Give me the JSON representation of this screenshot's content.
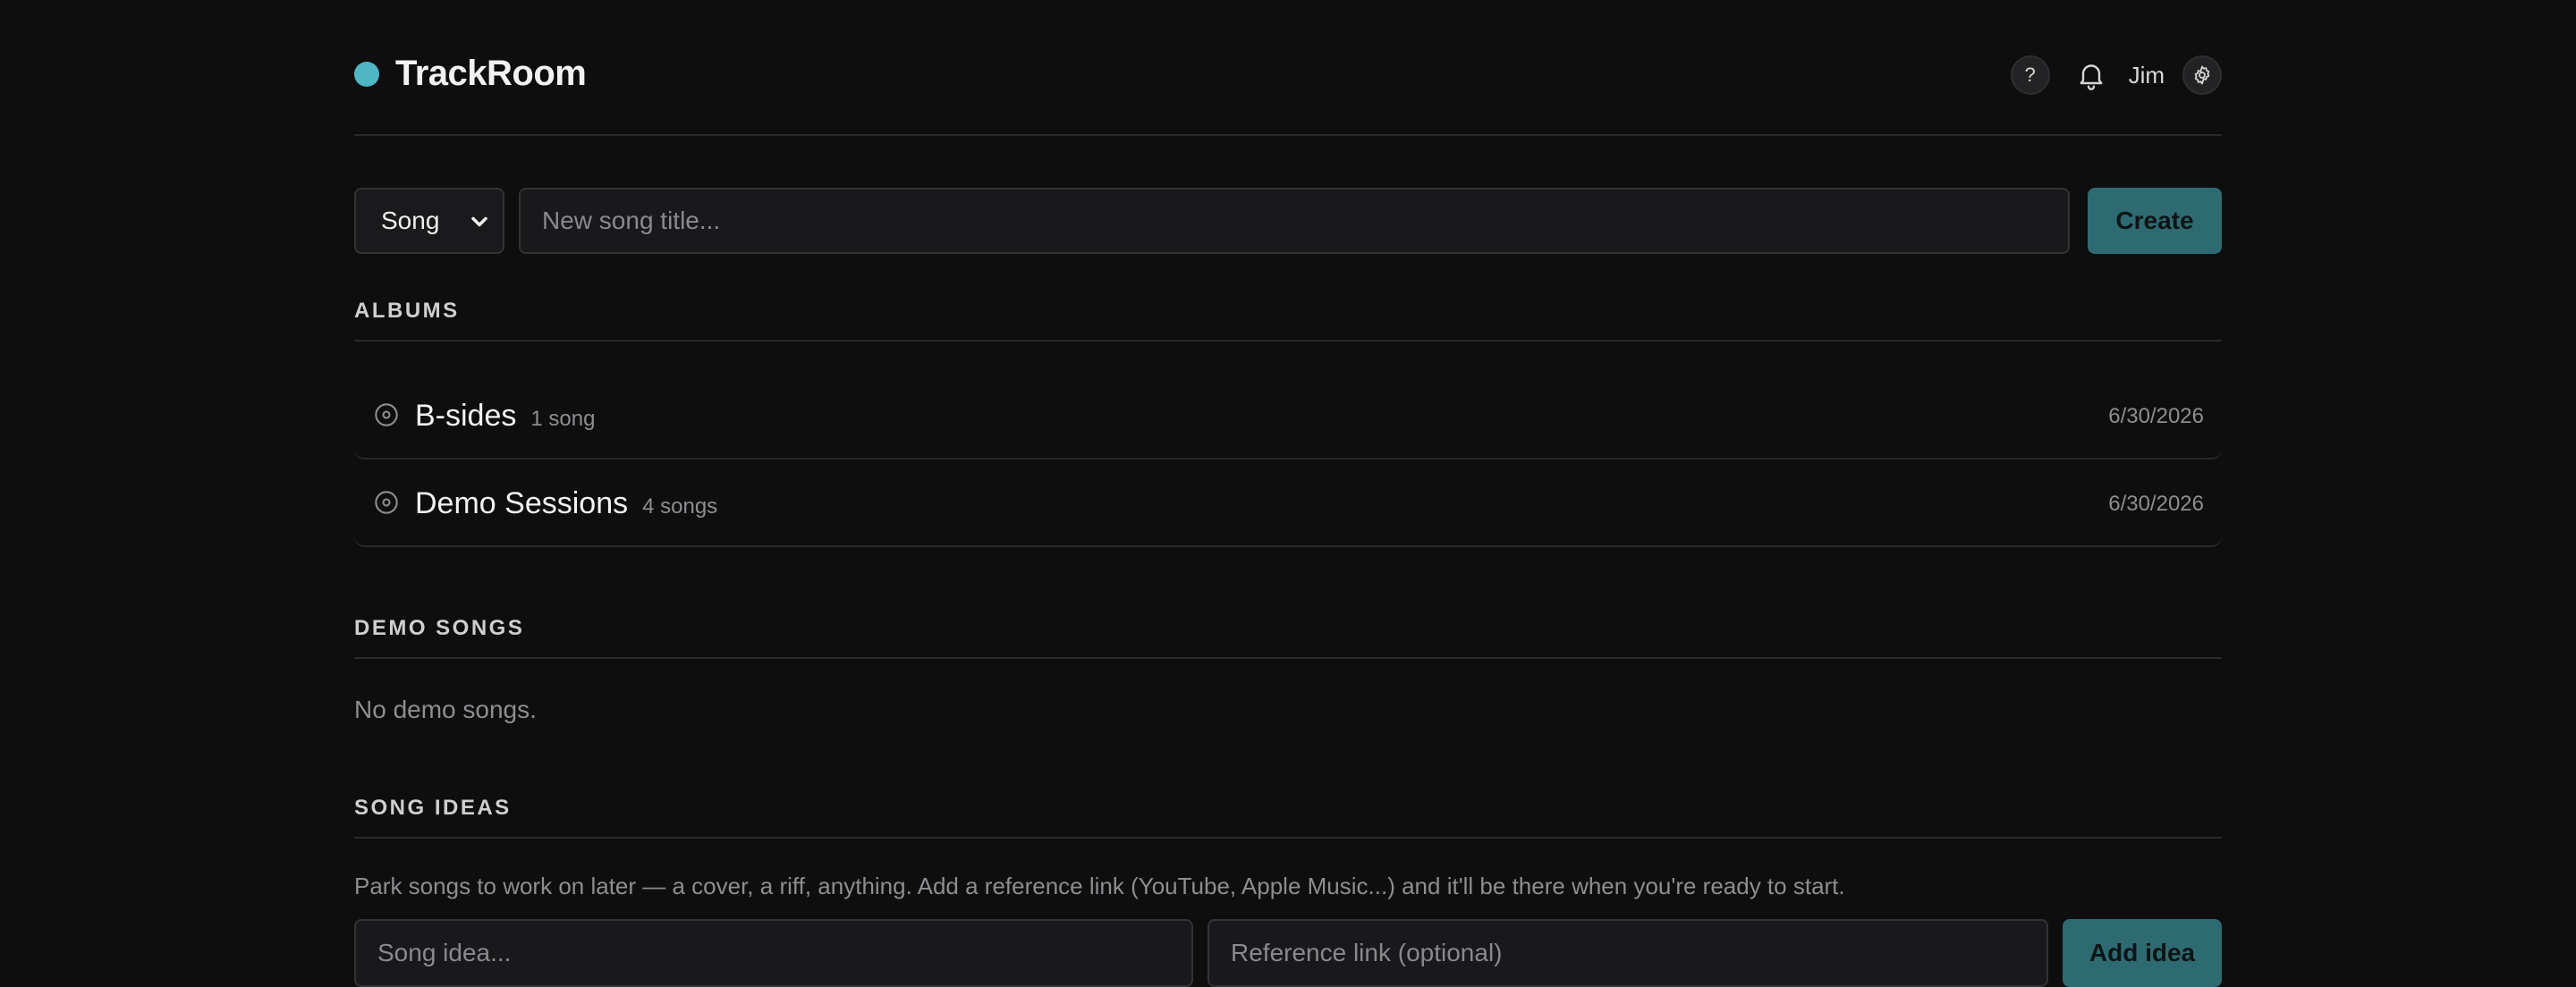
{
  "app": {
    "name": "TrackRoom",
    "accent_color": "#4fb6c6"
  },
  "header": {
    "help_label": "?",
    "user_name": "Jim",
    "icons": [
      "help-icon",
      "bell-icon",
      "gear-icon"
    ]
  },
  "create": {
    "type_selected": "Song",
    "title_placeholder": "New song title...",
    "button_label": "Create",
    "button_color": "#2e6a72"
  },
  "albums": {
    "title": "ALBUMS",
    "items": [
      {
        "name": "B-sides",
        "count": "1 song",
        "date": "6/30/2026"
      },
      {
        "name": "Demo Sessions",
        "count": "4 songs",
        "date": "6/30/2026"
      }
    ]
  },
  "demo_songs": {
    "title": "DEMO SONGS",
    "empty_text": "No demo songs."
  },
  "song_ideas": {
    "title": "SONG IDEAS",
    "help_text": "Park songs to work on later — a cover, a riff, anything. Add a reference link (YouTube, Apple Music...) and it'll be there when you're ready to start.",
    "idea_placeholder": "Song idea...",
    "link_placeholder": "Reference link (optional)",
    "button_label": "Add idea"
  }
}
